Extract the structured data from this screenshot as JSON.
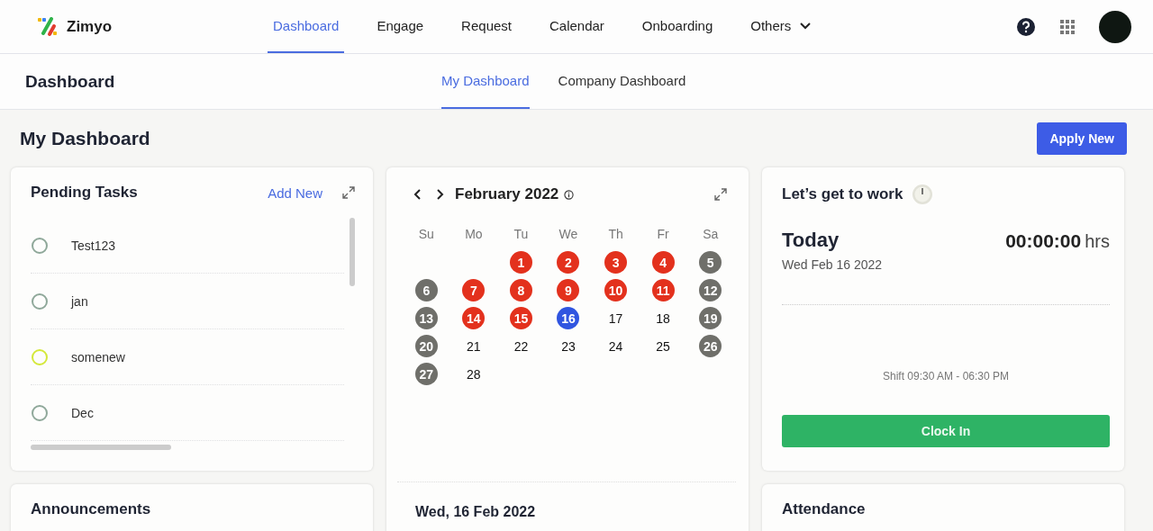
{
  "brand": {
    "name": "Zimyo"
  },
  "nav": [
    {
      "label": "Dashboard",
      "selected": true
    },
    {
      "label": "Engage",
      "selected": false
    },
    {
      "label": "Request",
      "selected": false
    },
    {
      "label": "Calendar",
      "selected": false
    },
    {
      "label": "Onboarding",
      "selected": false
    },
    {
      "label": "Others",
      "selected": false,
      "dropdown": true
    }
  ],
  "section_title": "Dashboard",
  "sub_tabs": [
    {
      "label": "My Dashboard",
      "selected": true
    },
    {
      "label": "Company Dashboard",
      "selected": false
    }
  ],
  "page_title": "My Dashboard",
  "apply_button": "Apply New",
  "pending_tasks": {
    "title": "Pending Tasks",
    "add_link": "Add New",
    "tasks": [
      {
        "label": "Test123",
        "color": "#8fa89a"
      },
      {
        "label": "jan",
        "color": "#8fa89a"
      },
      {
        "label": "somenew",
        "color": "#d4e83a"
      },
      {
        "label": "Dec",
        "color": "#8fa89a"
      }
    ]
  },
  "calendar": {
    "month": "February 2022",
    "weekdays": [
      "Su",
      "Mo",
      "Tu",
      "We",
      "Th",
      "Fr",
      "Sa"
    ],
    "days": [
      {
        "day": "1",
        "color": "#e3311d"
      },
      {
        "day": "2",
        "color": "#e3311d"
      },
      {
        "day": "3",
        "color": "#e3311d"
      },
      {
        "day": "4",
        "color": "#e3311d"
      },
      {
        "day": "5",
        "color": "#6f6f6a"
      },
      {
        "day": "6",
        "color": "#6f6f6a"
      },
      {
        "day": "7",
        "color": "#e3311d"
      },
      {
        "day": "8",
        "color": "#e3311d"
      },
      {
        "day": "9",
        "color": "#e3311d"
      },
      {
        "day": "10",
        "color": "#e3311d"
      },
      {
        "day": "11",
        "color": "#e3311d"
      },
      {
        "day": "12",
        "color": "#6f6f6a"
      },
      {
        "day": "13",
        "color": "#6f6f6a"
      },
      {
        "day": "14",
        "color": "#e3311d"
      },
      {
        "day": "15",
        "color": "#e3311d"
      },
      {
        "day": "16",
        "color": "#3055e0"
      },
      {
        "day": "17"
      },
      {
        "day": "18"
      },
      {
        "day": "19",
        "color": "#6f6f6a"
      },
      {
        "day": "20",
        "color": "#6f6f6a"
      },
      {
        "day": "21"
      },
      {
        "day": "22"
      },
      {
        "day": "23"
      },
      {
        "day": "24"
      },
      {
        "day": "25"
      },
      {
        "day": "26",
        "color": "#6f6f6a"
      },
      {
        "day": "27",
        "color": "#6f6f6a"
      },
      {
        "day": "28"
      }
    ],
    "selected_date": "Wed, 16 Feb 2022"
  },
  "work": {
    "title": "Let’s get to work",
    "today_label": "Today",
    "date": "Wed Feb 16 2022",
    "timer": "00:00:00",
    "timer_unit": "hrs",
    "shift": "Shift 09:30 AM - 06:30 PM",
    "clock_button": "Clock In"
  },
  "lower_cards": [
    {
      "title": "Announcements"
    },
    {
      "title": "Attendance"
    }
  ]
}
